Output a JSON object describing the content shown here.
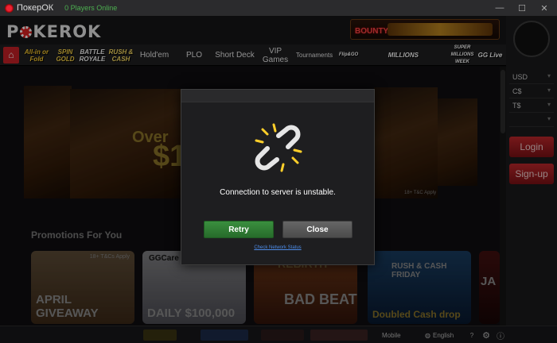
{
  "window": {
    "title": "ПокерОК",
    "online": "0 Players Online",
    "min": "—",
    "max": "☐",
    "close": "✕"
  },
  "brand": {
    "logo_left": "P",
    "logo_right": "KEROK"
  },
  "bounty": {
    "label": "BOUNTY"
  },
  "nav": {
    "home_icon": "home-icon",
    "items": [
      {
        "label": "All-in or Fold"
      },
      {
        "label": "SPIN GOLD"
      },
      {
        "label": "BATTLE ROYALE"
      },
      {
        "label": "RUSH & CASH"
      },
      {
        "label": "Hold'em"
      },
      {
        "label": "PLO"
      },
      {
        "label": "Short Deck"
      },
      {
        "label": "VIP Games"
      },
      {
        "label": "Tournaments"
      },
      {
        "label": "Flip&GO"
      },
      {
        "label": "MILLIONS"
      },
      {
        "label": "SUPER MILLIONS WEEK"
      },
      {
        "label": "GG Live"
      }
    ]
  },
  "sidebar": {
    "currencies": [
      "USD",
      "C$",
      "T$",
      ""
    ],
    "login": "Login",
    "signup": "Sign-up"
  },
  "banner": {
    "text_over": "Over",
    "text_amount": "$1",
    "terms": "18+ T&C Apply"
  },
  "promotions": {
    "title": "Promotions For You",
    "cards": [
      {
        "title": "APRIL GIVEAWAY",
        "tag": "18+ T&Cs Apply"
      },
      {
        "title": "DAILY $100,000",
        "tag": "GGCare"
      },
      {
        "title": "BAD BEAT",
        "tag": "REBIRTH"
      },
      {
        "title": "Doubled Cash drop",
        "tag": "RUSH & CASH FRIDAY"
      },
      {
        "title": "JA",
        "tag": ""
      }
    ]
  },
  "footer": {
    "items": [
      "Mobile",
      "English"
    ],
    "help": "?",
    "settings": "gear-icon"
  },
  "dialog": {
    "message": "Connection to server is unstable.",
    "retry": "Retry",
    "close": "Close",
    "link": "Check Network Status"
  },
  "colors": {
    "brand_red": "#c82127",
    "retry_green": "#3a8f3f",
    "link_blue": "#4d8ce8"
  }
}
